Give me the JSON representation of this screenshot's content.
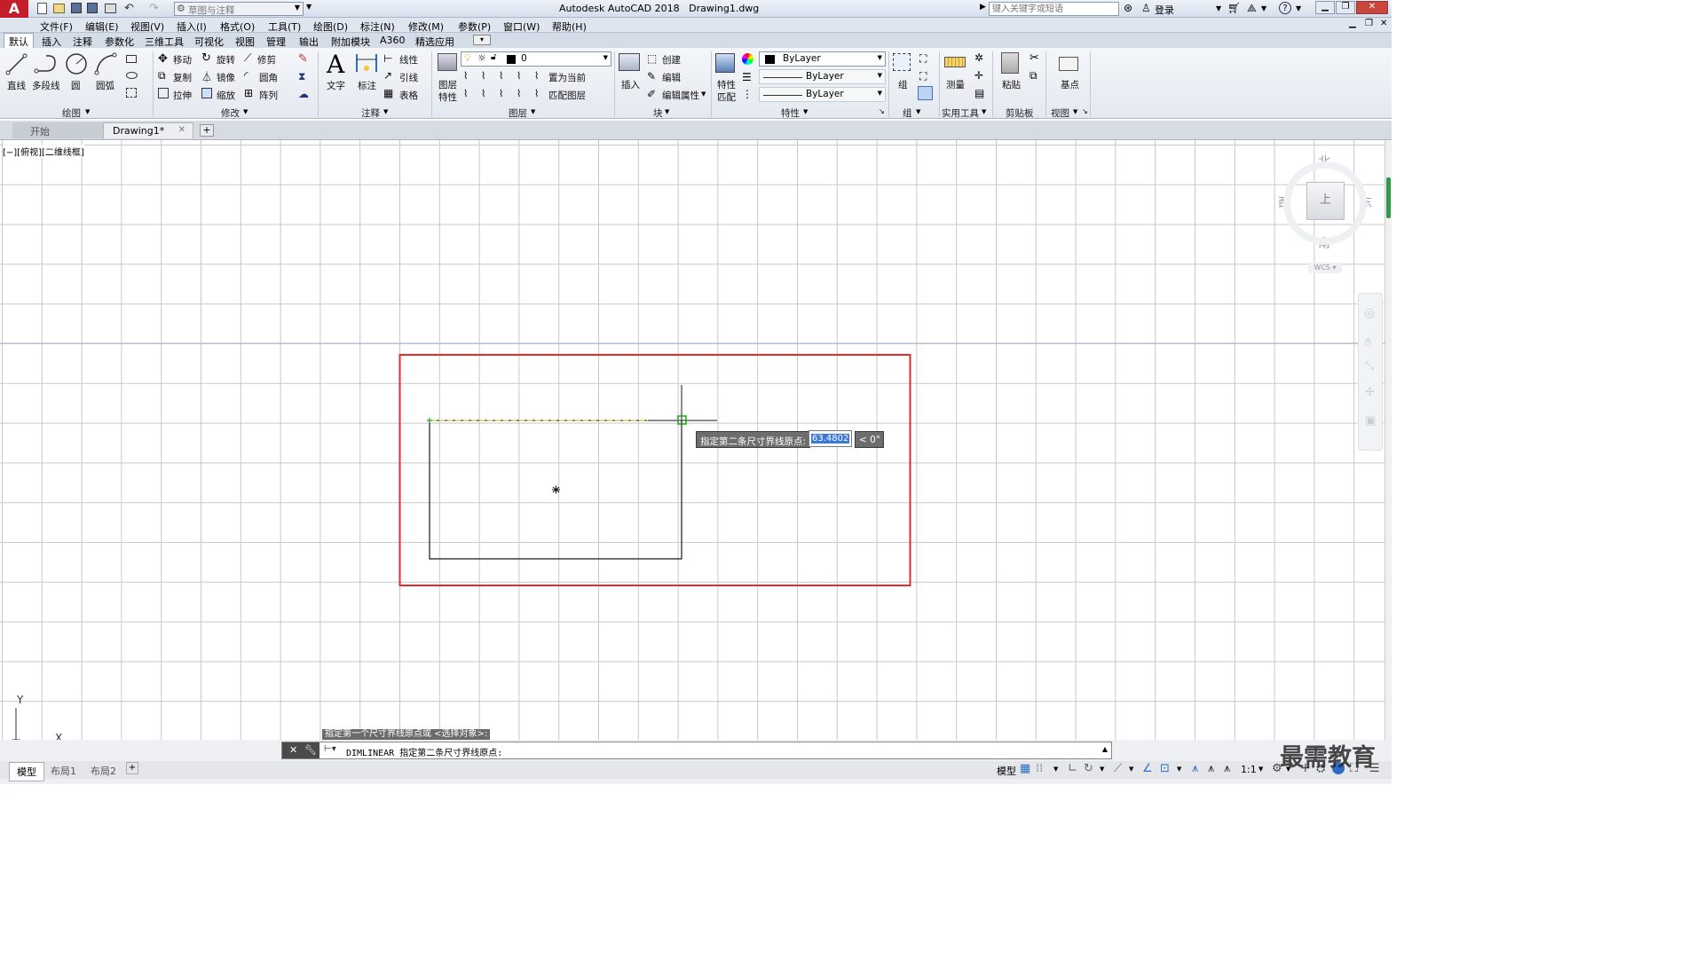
{
  "app": {
    "title": "Autodesk AutoCAD 2018",
    "document": "Drawing1.dwg",
    "logo_letter": "A",
    "workspace": "草图与注释",
    "search_placeholder": "键入关键字或短语",
    "login_label": "登录",
    "help_icon": "?"
  },
  "menu": [
    "文件(F)",
    "编辑(E)",
    "视图(V)",
    "插入(I)",
    "格式(O)",
    "工具(T)",
    "绘图(D)",
    "标注(N)",
    "修改(M)",
    "参数(P)",
    "窗口(W)",
    "帮助(H)"
  ],
  "ribbon_tabs": [
    "默认",
    "插入",
    "注释",
    "参数化",
    "三维工具",
    "可视化",
    "视图",
    "管理",
    "输出",
    "附加模块",
    "A360",
    "精选应用"
  ],
  "ribbon": {
    "draw": {
      "line": "直线",
      "polyline": "多段线",
      "circle": "圆",
      "arc": "圆弧",
      "group": "绘图"
    },
    "modify": {
      "move": "移动",
      "rotate": "旋转",
      "trim": "修剪",
      "copy": "复制",
      "mirror": "镜像",
      "fillet": "圆角",
      "stretch": "拉伸",
      "scale": "缩放",
      "array": "阵列",
      "group": "修改"
    },
    "annotation": {
      "text": "文字",
      "dimension": "标注",
      "linear": "线性",
      "leader": "引线",
      "table": "表格",
      "group": "注释"
    },
    "layers": {
      "layer_props_1": "图层",
      "layer_props_2": "特性",
      "current_layer": "0",
      "set_current": "置为当前",
      "match_layer": "匹配图层",
      "group": "图层"
    },
    "block": {
      "insert": "插入",
      "create": "创建",
      "edit": "编辑",
      "edit_attr": "编辑属性",
      "group": "块"
    },
    "properties": {
      "match_1": "特性",
      "match_2": "匹配",
      "color": "ByLayer",
      "linetype": "ByLayer",
      "lineweight": "ByLayer",
      "group": "特性"
    },
    "groups": {
      "group": "组",
      "group_label": "组"
    },
    "utilities": {
      "measure": "测量",
      "group": "实用工具"
    },
    "clipboard": {
      "paste": "粘贴",
      "group": "剪贴板"
    },
    "view": {
      "base": "基点",
      "group": "视图"
    }
  },
  "doc_tabs": {
    "start": "开始",
    "drawing": "Drawing1*"
  },
  "viewport": {
    "label": "[−][俯视][二维线框]",
    "viewcube": {
      "north": "北",
      "south": "南",
      "east": "东",
      "west": "西",
      "top": "上",
      "wcs": "WCS"
    },
    "ucs": {
      "x": "X",
      "y": "Y"
    }
  },
  "dynamic_input": {
    "prompt": "指定第二条尺寸界线原点:",
    "value": "63.4802",
    "angle": "< 0°"
  },
  "command": {
    "history": "指定第一个尺寸界线原点或 <选择对象>:",
    "current": "DIMLINEAR 指定第二条尺寸界线原点:"
  },
  "layout_tabs": [
    "模型",
    "布局1",
    "布局2"
  ],
  "status": {
    "model": "模型",
    "scale": "1:1"
  },
  "watermark": "最需教育",
  "colors": {
    "highlight_box": "#e52b2b",
    "snap_marker": "#22aa22",
    "grid": "#c9c9c9"
  }
}
